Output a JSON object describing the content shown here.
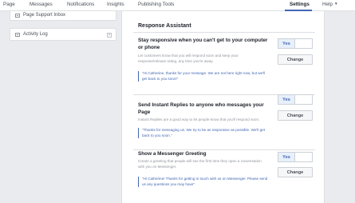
{
  "nav": {
    "items": [
      "Page",
      "Messages",
      "Notifications",
      "Insights",
      "Publishing Tools"
    ],
    "settings": "Settings",
    "help": "Help"
  },
  "sidebar": {
    "page_support_inbox": "Page Support Inbox",
    "activity_log": "Activity Log",
    "plus": "+"
  },
  "main": {
    "title": "Response Assistant",
    "sections": [
      {
        "title": "Stay responsive when you can't get to your computer or phone",
        "description": "Let customers know that you will respond soon and keep your response/release rating, any time you're away.",
        "quote": "\"Hi Catherine, thanks for your message. We are not here right now, but we'll get back to you soon!\"",
        "toggle": "Yes",
        "button": "Change"
      },
      {
        "title": "Send Instant Replies to anyone who messages your Page",
        "description": "Instant Replies are a good way to let people know that you'll respond soon.",
        "quote": "\"Thanks for messaging us. We try to be as responsive as possible. We'll get back to you soon.\"",
        "toggle": "Yes",
        "button": "Change"
      },
      {
        "title": "Show a Messenger Greeting",
        "description": "Create a greeting that people will see the first time they open a conversation with you on Messenger.",
        "quote": "\"Hi Catherine! Thanks for getting in touch with us on Messenger. Please send us any questions you may have\"",
        "toggle": "Yes",
        "button": "Change"
      }
    ]
  }
}
